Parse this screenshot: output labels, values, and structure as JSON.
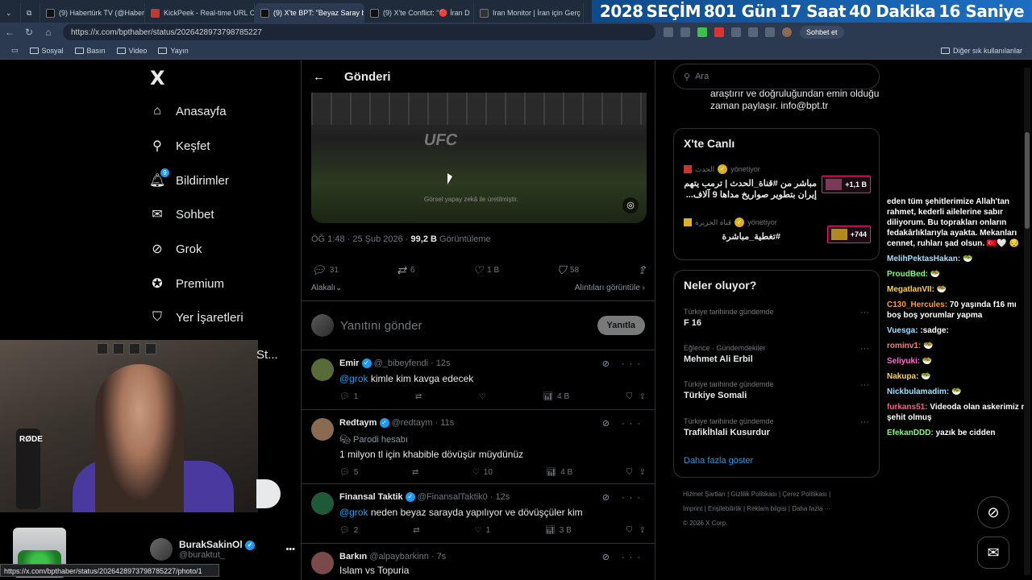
{
  "browser": {
    "tabs": [
      {
        "label": "(9) Habertürk TV (@Habert",
        "color": "#1d1d1d"
      },
      {
        "label": "KickPeek - Real-time URL C",
        "color": "#c0392b"
      },
      {
        "label": "(9) X'te BPT: \"Beyaz Saray b",
        "color": "#000000",
        "active": true
      },
      {
        "label": "(9) X'te Conflict: \"🔴 İran D",
        "color": "#000000"
      },
      {
        "label": "Iran Monitor | İran için Gerç",
        "color": "#333333"
      }
    ],
    "countdown": [
      "2028",
      "SEÇİM",
      "801 Gün",
      "17 Saat",
      "40 Dakika",
      "16 Saniye"
    ],
    "url": "https://x.com/bpthaber/status/2026428973798785227",
    "copilot_label": "Sohbet et",
    "bookmarks": [
      "Sosyal",
      "Basın",
      "Video",
      "Yayın"
    ],
    "other_bookmarks": "Diğer sık kullanılanlar",
    "status_url": "https://x.com/bpthaber/status/2026428973798785227/photo/1"
  },
  "sidebar": {
    "logo": "X",
    "items": [
      {
        "label": "Anasayfa",
        "icon": "home-icon"
      },
      {
        "label": "Keşfet",
        "icon": "search-icon"
      },
      {
        "label": "Bildirimler",
        "icon": "bell-icon",
        "badge": "9"
      },
      {
        "label": "Sohbet",
        "icon": "mail-icon"
      },
      {
        "label": "Grok",
        "icon": "grok-icon"
      },
      {
        "label": "Premium",
        "icon": "premium-icon"
      },
      {
        "label": "Yer İşaretleri",
        "icon": "bookmark-icon"
      }
    ],
    "overlay_text": "St...",
    "profile": {
      "name": "BurakSakinOl",
      "handle": "@buraktut_",
      "more": "•••"
    }
  },
  "webcam": {
    "mic_brand": "RØDE"
  },
  "main": {
    "header_title": "Gönderi",
    "media_brand": "UFC",
    "media_disclaimer": "Görsel yapay zekâ ile üretilmiştir.",
    "time": "ÖĞ 1:48 · 25 Şub 2026 · ",
    "views": "99,2 B",
    "views_label": " Görüntüleme",
    "stats": {
      "replies": "31",
      "reposts": "6",
      "likes": "1 B",
      "bookmarks": "58"
    },
    "sort_label": "Alakalı",
    "quotes_label": "Alıntıları görüntüle",
    "reply_placeholder": "Yanıtını gönder",
    "reply_button": "Yanıtla",
    "replies": [
      {
        "name": "Emir",
        "handle": "@_bibeyfendi · 12s",
        "mention": "@grok",
        "text": " kimle kim kavga edecek",
        "parody": "",
        "stats": {
          "r": "1",
          "rt": "",
          "l": "",
          "v": "4 B"
        },
        "color": "#5a6b3a"
      },
      {
        "name": "Redtaym",
        "handle": "@redtaym · 11s",
        "mention": "",
        "text": "1 milyon tl için khabible dövüşür müydünüz",
        "parody": "Parodi hesabı",
        "stats": {
          "r": "5",
          "rt": "",
          "l": "10",
          "v": "4 B"
        },
        "color": "#8a6a50"
      },
      {
        "name": "Finansal Taktik",
        "handle": "@FinansalTaktik0 · 12s",
        "mention": "@grok",
        "text": " neden beyaz sarayda yapılıyor ve dövüşçüler kim",
        "parody": "",
        "stats": {
          "r": "2",
          "rt": "",
          "l": "1",
          "v": "3 B"
        },
        "color": "#1e5a3a"
      },
      {
        "name": "Barkın",
        "handle": "@alpaybarkinn · 7s",
        "mention": "",
        "text": "Islam vs Topuria",
        "parody": "",
        "stats": {
          "r": "",
          "rt": "",
          "l": "",
          "v": ""
        },
        "color": "#7a4a4a"
      }
    ]
  },
  "right": {
    "search_placeholder": "Ara",
    "trusted_text": "araştırır ve doğruluğundan emin olduğu zaman paylaşır. info@bpt.tr",
    "live_title": "X'te Canlı",
    "live": [
      {
        "host": "الحدث",
        "role": "yönetiyor",
        "title": "مباشر من #قناة_الحدث | ترمب يتهم إيران بتطوير صواريخ مداها 9 آلاف...",
        "count": "+1,1 B"
      },
      {
        "host": "قناة الجزيرة",
        "role": "yönetiyor",
        "title": "#تغطية_مباشرة",
        "count": "+744"
      }
    ],
    "happening_title": "Neler oluyor?",
    "trends": [
      {
        "cat": "Türkiye tarihinde gündemde",
        "name": "F 16"
      },
      {
        "cat": "Eğlence · Gündemdekiler",
        "name": "Mehmet Ali Erbil"
      },
      {
        "cat": "Türkiye tarihinde gündemde",
        "name": "Türkiye Somali"
      },
      {
        "cat": "Türkiye tarihinde gündemde",
        "name": "Trafikİhlali Kusurdur"
      }
    ],
    "more": "Daha fazla göster",
    "footer": [
      "Hizmet Şartları",
      "Gizlilik Politikası",
      "Çerez Politikası",
      "İmprint",
      "Erişilebilirlik",
      "Reklam bilgisi",
      "Daha fazla ···",
      "© 2026 X Corp."
    ]
  },
  "chat": [
    {
      "user": "",
      "text": "eden tüm şehitlerimize Allah'tan rahmet, kederli ailelerine sabır diliyorum. Bu toprakları onların fedakârlıklarıyla ayakta. Mekanları cennet, ruhları şad olsun. 🇹🇷🤍 😔",
      "color": "#ffffff"
    },
    {
      "user": "MelihPektasHakan:",
      "text": "🥗",
      "color": "#a0e0ff"
    },
    {
      "user": "ProudBed:",
      "text": "🥗",
      "color": "#7cfc7c"
    },
    {
      "user": "MegatlanVII:",
      "text": "🥗",
      "color": "#ffd24a"
    },
    {
      "user": "C130_Hercules:",
      "text": "70 yaşında f16 mı boş boş yorumlar yapma",
      "color": "#ff9a3c"
    },
    {
      "user": "Vuesga:",
      "text": ":sadge:",
      "color": "#a0e0ff"
    },
    {
      "user": "rominv1:",
      "text": "🥗",
      "color": "#ff7a7a"
    },
    {
      "user": "Seliyuki:",
      "text": "🥗",
      "color": "#ff6ad5"
    },
    {
      "user": "Nakupa:",
      "text": "🥗",
      "color": "#ffd24a"
    },
    {
      "user": "Nickbulamadim:",
      "text": "🥗",
      "color": "#a0e0ff"
    },
    {
      "user": "furkans51:",
      "text": "Videoda olan askerimiz mi şehit olmuş",
      "color": "#ff5a8a"
    },
    {
      "user": "EfekanDDD:",
      "text": "yazık be cidden",
      "color": "#7cfc7c"
    }
  ]
}
